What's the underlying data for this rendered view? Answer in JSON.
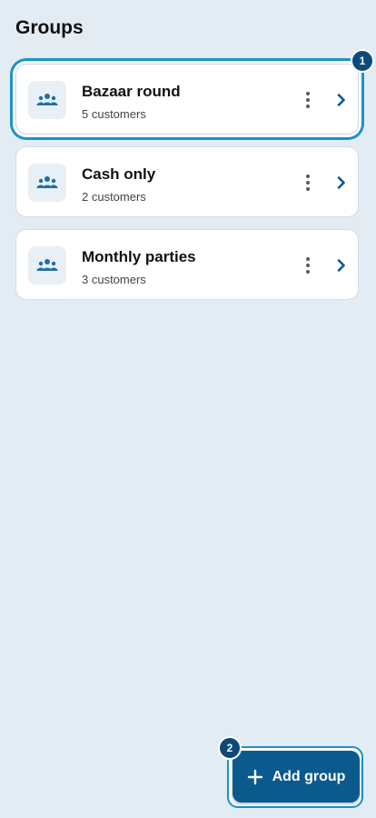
{
  "page": {
    "title": "Groups"
  },
  "groups": [
    {
      "name": "Bazaar round",
      "count": "5 customers"
    },
    {
      "name": "Cash only",
      "count": "2 customers"
    },
    {
      "name": "Monthly parties",
      "count": "3 customers"
    }
  ],
  "badges": {
    "first": "1",
    "second": "2"
  },
  "fab": {
    "label": "Add group",
    "icon": "plus-icon"
  },
  "colors": {
    "background": "#e3ecf3",
    "accent": "#0b5a8e",
    "highlight": "#1a93c6",
    "badge": "#0d4a7a"
  }
}
